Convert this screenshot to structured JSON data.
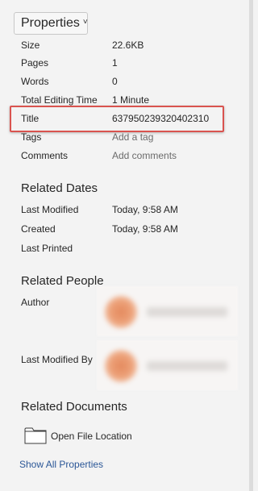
{
  "properties_button": {
    "label": "Properties",
    "chevron": "˅"
  },
  "properties": [
    {
      "label": "Size",
      "value": "22.6KB",
      "editable": false
    },
    {
      "label": "Pages",
      "value": "1",
      "editable": false
    },
    {
      "label": "Words",
      "value": "0",
      "editable": false
    },
    {
      "label": "Total Editing Time",
      "value": "1 Minute",
      "editable": false
    },
    {
      "label": "Title",
      "value": "637950239320402310",
      "editable": true,
      "highlighted": true
    },
    {
      "label": "Tags",
      "value": "Add a tag",
      "editable": true,
      "placeholder": true
    },
    {
      "label": "Comments",
      "value": "Add comments",
      "editable": true,
      "placeholder": true
    }
  ],
  "related_dates": {
    "title": "Related Dates",
    "items": [
      {
        "label": "Last Modified",
        "value": "Today, 9:58 AM"
      },
      {
        "label": "Created",
        "value": "Today, 9:58 AM"
      },
      {
        "label": "Last Printed",
        "value": ""
      }
    ]
  },
  "related_people": {
    "title": "Related People",
    "items": [
      {
        "label": "Author",
        "avatar_icon": "person-avatar-icon",
        "name_obscured": true
      },
      {
        "label": "Last Modified By",
        "avatar_icon": "person-avatar-icon",
        "name_obscured": true
      }
    ]
  },
  "related_documents": {
    "title": "Related Documents",
    "open_location": {
      "icon": "folder-icon",
      "label": "Open File Location"
    }
  },
  "show_all_link": "Show All Properties",
  "colors": {
    "background": "#f3f3f3",
    "highlight_border": "#d9534f",
    "link": "#2b5797",
    "hint_text": "#6b6b6b"
  }
}
